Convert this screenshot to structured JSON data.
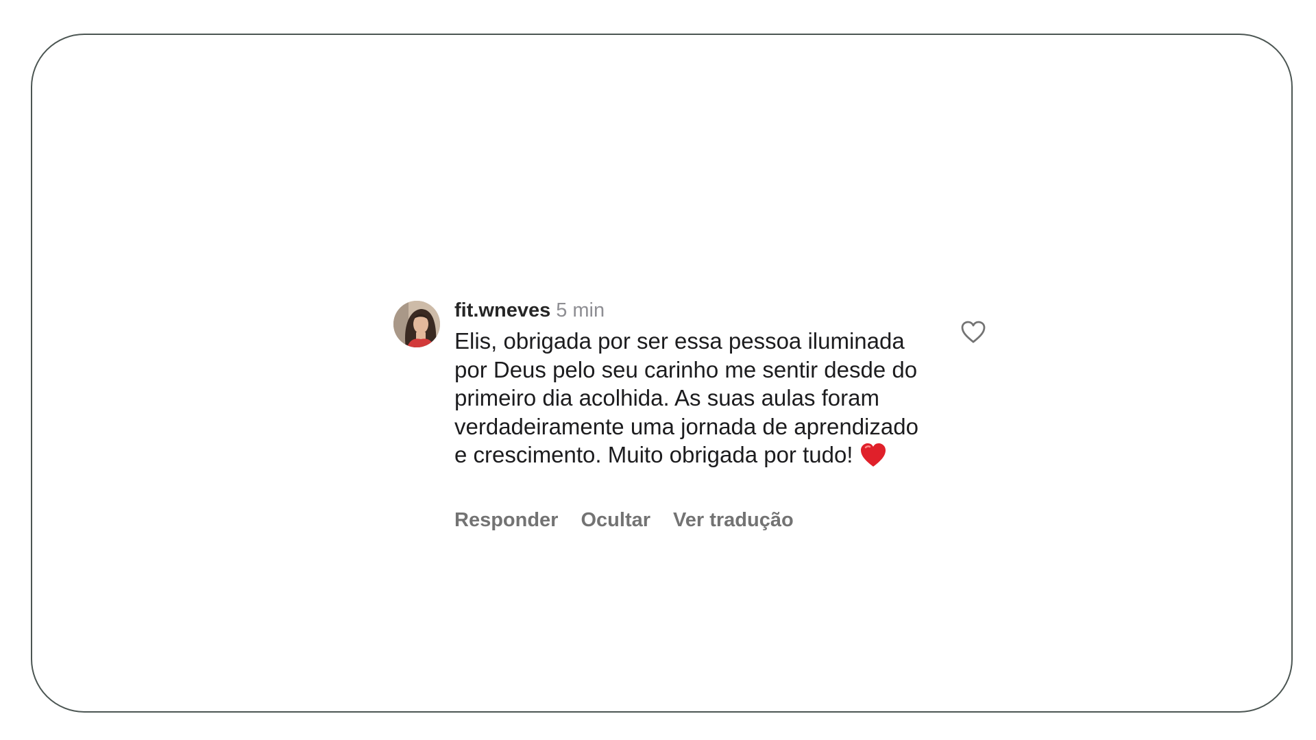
{
  "comment": {
    "username": "fit.wneves",
    "time": "5 min",
    "text": "Elis, obrigada por ser essa pessoa iluminada por Deus pelo seu carinho me sentir desde do primeiro dia acolhida. As suas aulas foram verdadeiramente uma jornada de aprendizado e crescimento. Muito obrigada por tudo!",
    "emoji_icon": "red-heart-emoji",
    "actions": {
      "reply": "Responder",
      "hide": "Ocultar",
      "translate": "Ver tradução"
    },
    "like_icon": "heart-outline-icon"
  },
  "colors": {
    "username": "#262626",
    "muted": "#8e8e93",
    "actions": "#737373",
    "text": "#1c1c1e",
    "emoji_red": "#e0202a",
    "frame_border": "#4b5552"
  }
}
